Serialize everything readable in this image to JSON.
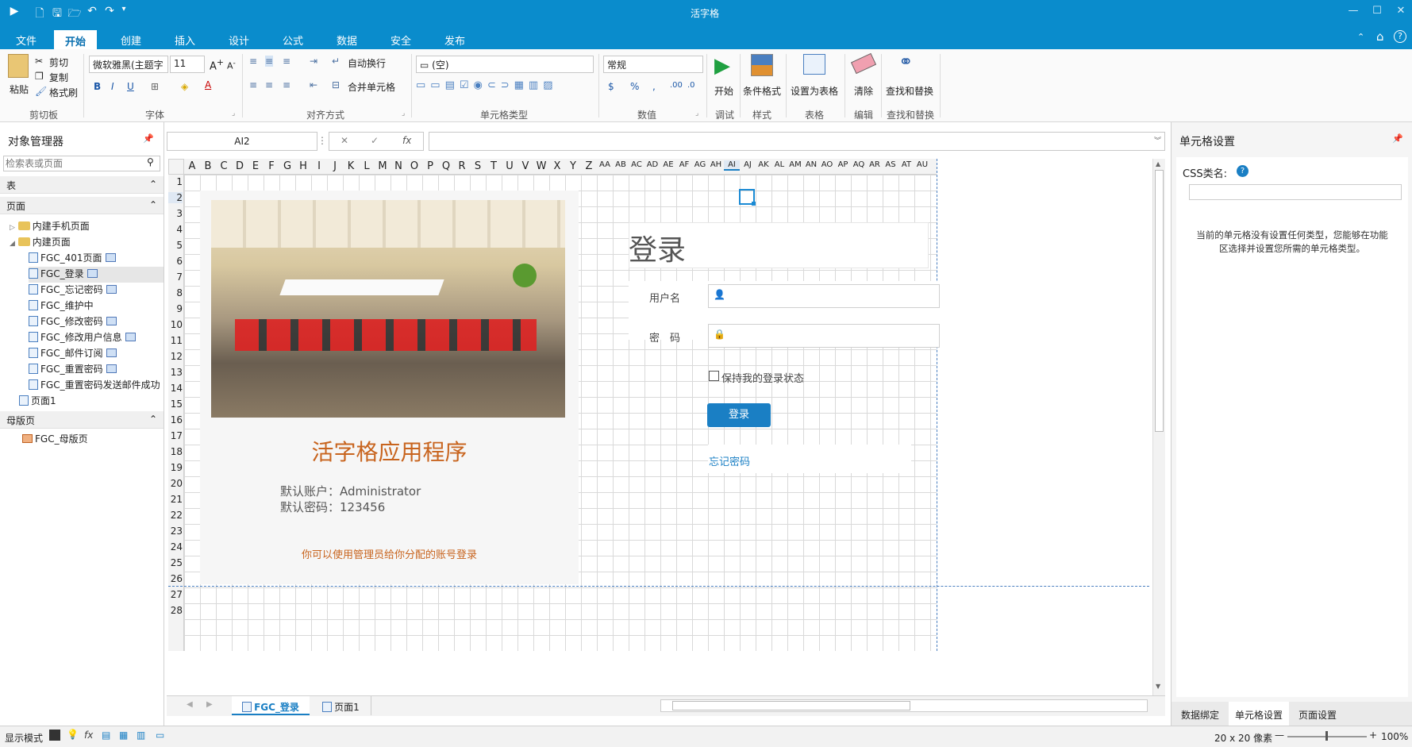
{
  "app": {
    "title": "活字格"
  },
  "ribbon_tabs": [
    "文件",
    "开始",
    "创建",
    "插入",
    "设计",
    "公式",
    "数据",
    "安全",
    "发布"
  ],
  "ribbon": {
    "clipboard": {
      "paste": "粘贴",
      "cut": "剪切",
      "copy": "复制",
      "format_painter": "格式刷",
      "label": "剪切板"
    },
    "font": {
      "family": "微软雅黑(主题字",
      "size": "11",
      "label": "字体"
    },
    "align": {
      "wrap": "自动换行",
      "merge": "合并单元格",
      "label": "对齐方式"
    },
    "celltype": {
      "value": "(空)",
      "label": "单元格类型"
    },
    "number": {
      "format": "常规",
      "label": "数值"
    },
    "debug": {
      "start": "开始",
      "label": "调试"
    },
    "style": {
      "cond": "条件格式",
      "label": "样式"
    },
    "table": {
      "set": "设置为表格",
      "label": "表格"
    },
    "edit": {
      "clear": "清除",
      "label": "编辑"
    },
    "find": {
      "find": "查找和替换",
      "label": "查找和替换"
    }
  },
  "left_panel": {
    "title": "对象管理器",
    "search_placeholder": "检索表或页面",
    "sections": {
      "tables": "表",
      "pages": "页面",
      "master": "母版页"
    },
    "tree": [
      {
        "label": "内建手机页面",
        "type": "folder"
      },
      {
        "label": "内建页面",
        "type": "folder"
      },
      {
        "label": "FGC_401页面",
        "type": "page"
      },
      {
        "label": "FGC_登录",
        "type": "page"
      },
      {
        "label": "FGC_忘记密码",
        "type": "page"
      },
      {
        "label": "FGC_维护中",
        "type": "page"
      },
      {
        "label": "FGC_修改密码",
        "type": "page"
      },
      {
        "label": "FGC_修改用户信息",
        "type": "page"
      },
      {
        "label": "FGC_邮件订阅",
        "type": "page"
      },
      {
        "label": "FGC_重置密码",
        "type": "page"
      },
      {
        "label": "FGC_重置密码发送邮件成功",
        "type": "page"
      },
      {
        "label": "页面1",
        "type": "page"
      }
    ],
    "master_item": "FGC_母版页"
  },
  "formula_bar": {
    "cell_ref": "AI2",
    "formula": ""
  },
  "columns": [
    "A",
    "B",
    "C",
    "D",
    "E",
    "F",
    "G",
    "H",
    "I",
    "J",
    "K",
    "L",
    "M",
    "N",
    "O",
    "P",
    "Q",
    "R",
    "S",
    "T",
    "U",
    "V",
    "W",
    "X",
    "Y",
    "Z",
    "AA",
    "AB",
    "AC",
    "AD",
    "AE",
    "AF",
    "AG",
    "AH",
    "AI",
    "AJ",
    "AK",
    "AL",
    "AM",
    "AN",
    "AO",
    "AP",
    "AQ",
    "AR",
    "AS",
    "AT",
    "AU"
  ],
  "rows": [
    "1",
    "2",
    "3",
    "4",
    "5",
    "6",
    "7",
    "8",
    "9",
    "10",
    "11",
    "12",
    "13",
    "14",
    "15",
    "16",
    "17",
    "18",
    "19",
    "20",
    "21",
    "22",
    "23",
    "24",
    "25",
    "26",
    "27",
    "28"
  ],
  "canvas": {
    "app_title": "活字格应用程序",
    "account_line": "默认账户：Administrator",
    "password_line": "默认密码：123456",
    "hint": "你可以使用管理员给你分配的账号登录",
    "login_title": "登录",
    "username_label": "用户名",
    "password_label": "密　码",
    "remember": "保持我的登录状态",
    "login_button": "登录",
    "forgot": "忘记密码"
  },
  "sheet_tabs": [
    "FGC_登录",
    "页面1"
  ],
  "right_panel": {
    "title": "单元格设置",
    "css_label": "CSS类名:",
    "info": "当前的单元格没有设置任何类型，您能够在功能区选择并设置您所需的单元格类型。",
    "tabs": [
      "数据绑定",
      "单元格设置",
      "页面设置"
    ]
  },
  "status": {
    "mode": "显示模式",
    "grid_size": "20 x 20 像素",
    "zoom": "100%"
  },
  "colors": {
    "accent": "#0a8ccc",
    "orange": "#c8641e",
    "link": "#1a7fc4"
  }
}
